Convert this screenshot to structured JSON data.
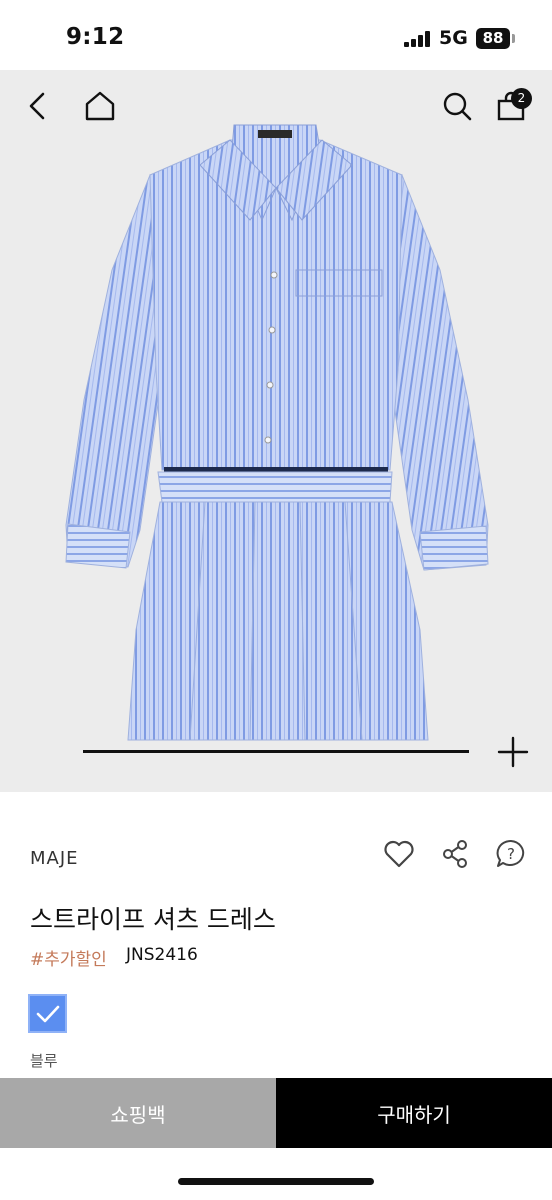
{
  "status_bar": {
    "time": "9:12",
    "network": "5G",
    "battery": "88"
  },
  "header": {
    "icons": [
      "back-icon",
      "home-icon",
      "search-icon",
      "shopping-bag-icon"
    ],
    "cart_count": "2"
  },
  "gallery": {
    "image": "striped-shirt-dress",
    "image_progress": 0.2
  },
  "product": {
    "brand": "MAJE",
    "name": "스트라이프 셔츠 드레스",
    "tag": "#추가할인",
    "code": "JNS2416",
    "selected_color": "블루",
    "swatch_color": "#5b8ef0"
  },
  "actions": {
    "icons": [
      "heart-icon",
      "share-icon",
      "question-bubble-icon"
    ]
  },
  "bottom_bar": {
    "cart_label": "쇼핑백",
    "buy_label": "구매하기"
  },
  "colors": {
    "tag": "#c47a5a",
    "cart_button": "#a8a8a8",
    "buy_button": "#000000"
  }
}
